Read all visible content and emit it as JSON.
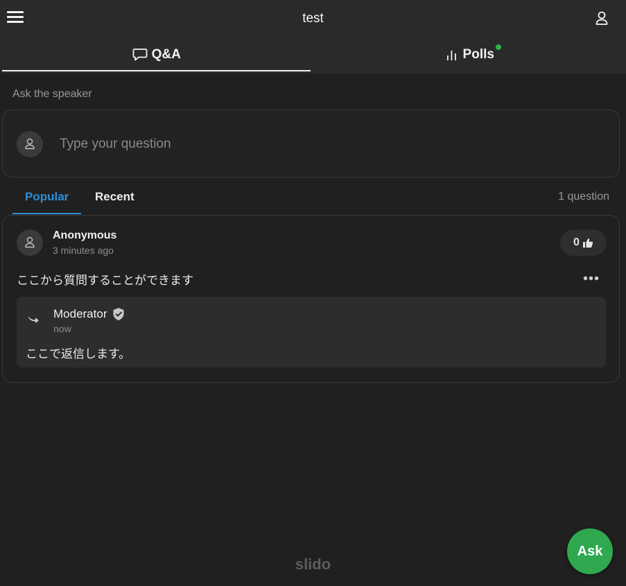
{
  "header": {
    "title": "test",
    "menu_icon": "hamburger-icon",
    "user_icon": "user-icon"
  },
  "tabs": [
    {
      "label": "Q&A",
      "icon": "chat-bubble-icon",
      "active": true
    },
    {
      "label": "Polls",
      "icon": "bar-chart-icon",
      "active": false,
      "notification_dot": true
    }
  ],
  "ask": {
    "label": "Ask the speaker",
    "placeholder": "Type your question"
  },
  "filters": {
    "popular": "Popular",
    "recent": "Recent",
    "active": "Popular",
    "count_text": "1 question"
  },
  "question": {
    "author": "Anonymous",
    "time": "3 minutes ago",
    "likes": "0",
    "text": "ここから質問することができます",
    "more": "•••",
    "reply": {
      "author": "Moderator",
      "time": "now",
      "text": "ここで返信します。"
    }
  },
  "footer": {
    "logo": "slido"
  },
  "fab": {
    "label": "Ask"
  },
  "colors": {
    "accent_blue": "#2f8fd8",
    "green": "#2fa84f",
    "background": "#202020",
    "header": "#2a2a2a"
  }
}
